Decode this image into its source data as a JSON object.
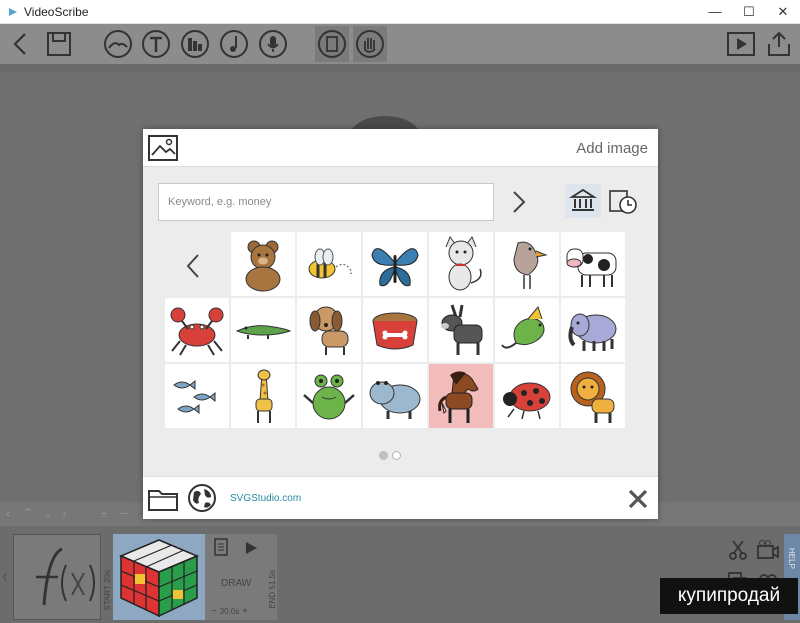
{
  "window": {
    "title": "VideoScribe",
    "minimize": "—",
    "maximize": "☐",
    "close": "✕"
  },
  "toolbar": {
    "items": [
      "back-icon",
      "save-icon",
      "image-icon",
      "text-icon",
      "chart-icon",
      "music-icon",
      "voiceover-icon",
      "script-icon",
      "hand-icon",
      "play-icon",
      "share-icon"
    ]
  },
  "dialog": {
    "title": "Add image",
    "search_placeholder": "Keyword, e.g. money",
    "footer_link": "SVGStudio.com",
    "page_count": 2,
    "current_page": 1,
    "images": [
      [
        "bear",
        "bee",
        "butterfly",
        "cat",
        "bird",
        "cow"
      ],
      [
        "crab",
        "crocodile",
        "dog",
        "dog-bowl",
        "donkey",
        "dragon",
        "elephant"
      ],
      [
        "fish",
        "giraffe",
        "frog",
        "hippo",
        "horse",
        "ladybug",
        "lion"
      ]
    ],
    "selected_image": "horse"
  },
  "timeline": {
    "draw_label": "DRAW",
    "duration": "30.0s",
    "start_label": "START",
    "start_value": "20s",
    "end_label": "END",
    "end_value": "51.5s",
    "help_label": "HELP"
  },
  "watermark": "купипродай",
  "colors": {
    "accent": "#2a8aa0",
    "selected_tile": "#f3bcbc",
    "toolbar": "#8c8c8c"
  }
}
